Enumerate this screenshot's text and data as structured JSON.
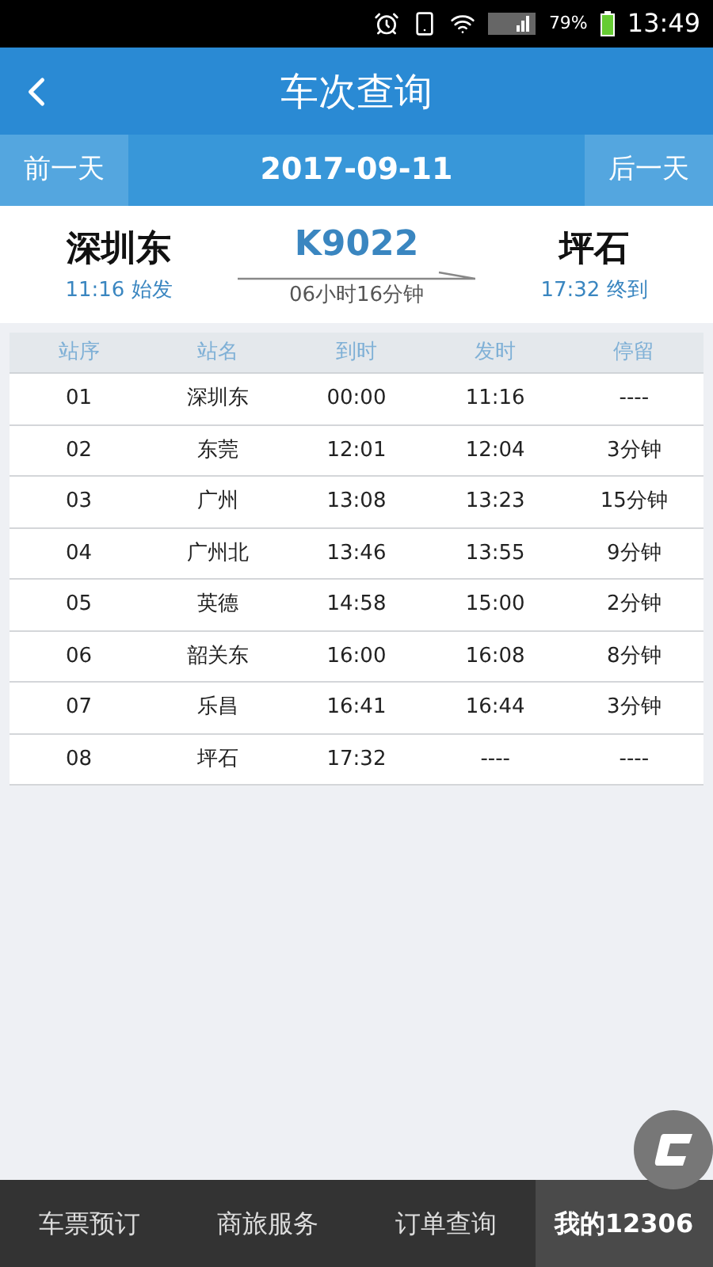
{
  "status_bar": {
    "battery": "79%",
    "time": "13:49"
  },
  "header": {
    "title": "车次查询"
  },
  "date_bar": {
    "prev": "前一天",
    "date": "2017-09-11",
    "next": "后一天"
  },
  "train": {
    "from": "深圳东",
    "depart": "11:16 始发",
    "number": "K9022",
    "duration": "06小时16分钟",
    "to": "坪石",
    "arrive": "17:32 终到"
  },
  "table": {
    "columns": [
      "站序",
      "站名",
      "到时",
      "发时",
      "停留"
    ],
    "rows": [
      [
        "01",
        "深圳东",
        "00:00",
        "11:16",
        "----"
      ],
      [
        "02",
        "东莞",
        "12:01",
        "12:04",
        "3分钟"
      ],
      [
        "03",
        "广州",
        "13:08",
        "13:23",
        "15分钟"
      ],
      [
        "04",
        "广州北",
        "13:46",
        "13:55",
        "9分钟"
      ],
      [
        "05",
        "英德",
        "14:58",
        "15:00",
        "2分钟"
      ],
      [
        "06",
        "韶关东",
        "16:00",
        "16:08",
        "8分钟"
      ],
      [
        "07",
        "乐昌",
        "16:41",
        "16:44",
        "3分钟"
      ],
      [
        "08",
        "坪石",
        "17:32",
        "----",
        "----"
      ]
    ]
  },
  "nav": [
    {
      "label": "车票预订",
      "selected": false
    },
    {
      "label": "商旅服务",
      "selected": false
    },
    {
      "label": "订单查询",
      "selected": false
    },
    {
      "label": "我的12306",
      "selected": true
    }
  ]
}
